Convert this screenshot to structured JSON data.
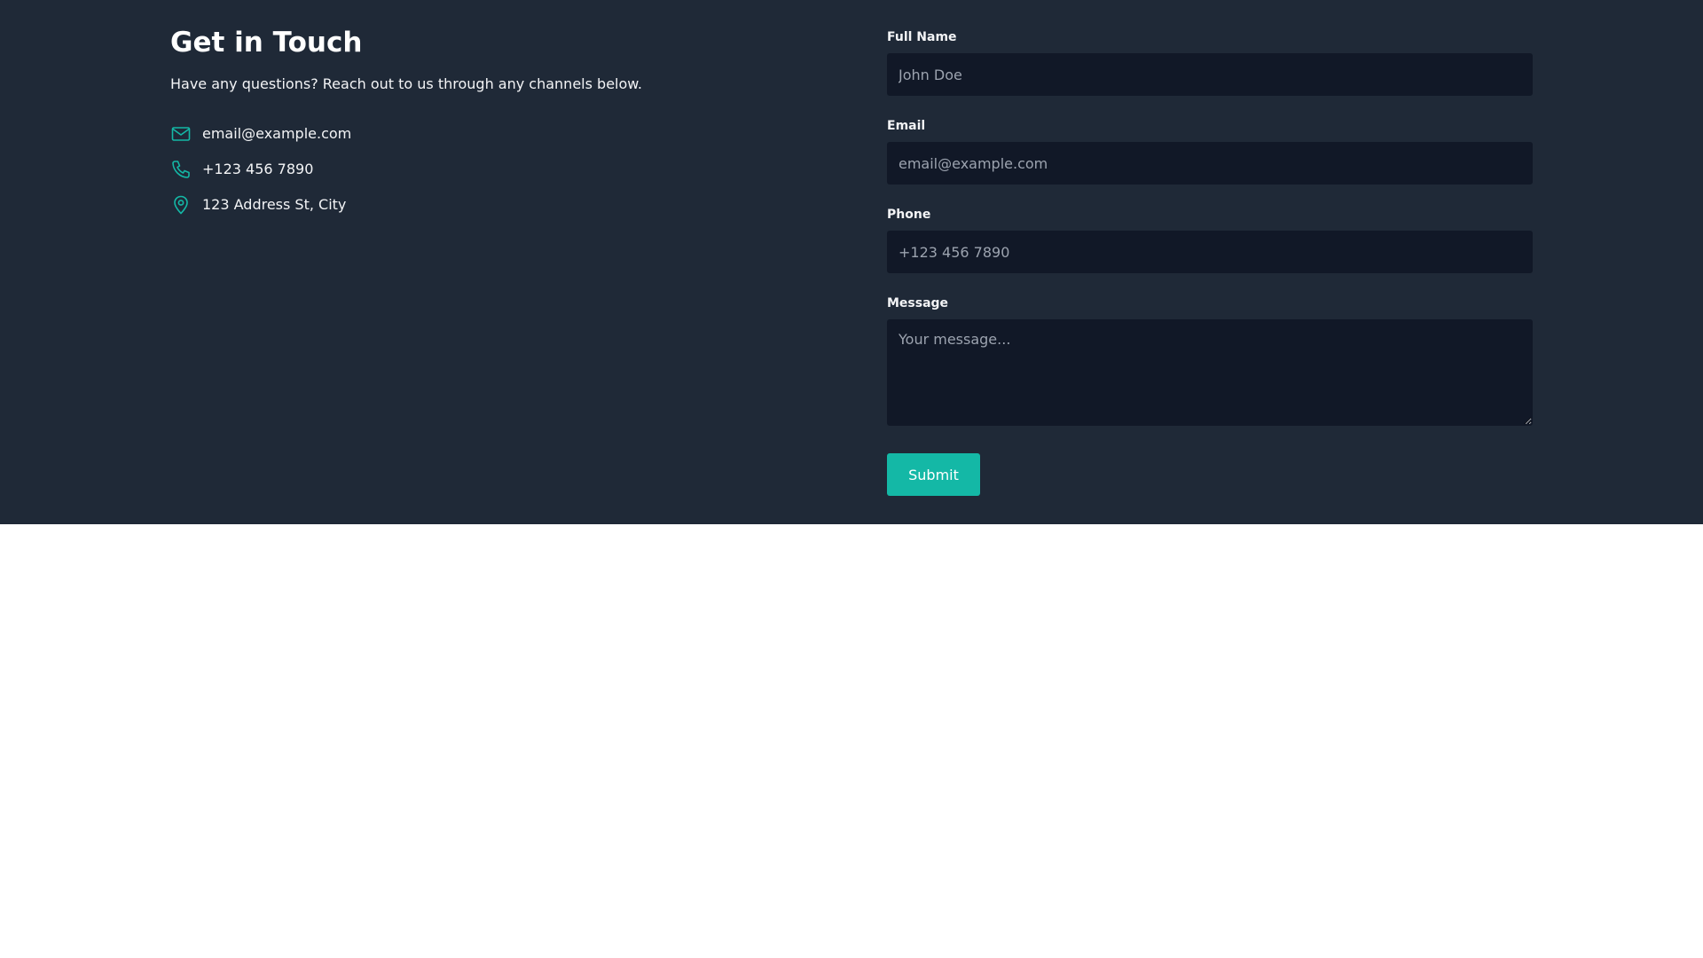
{
  "header": {
    "title": "Get in Touch",
    "subtitle": "Have any questions? Reach out to us through any channels below."
  },
  "contact_items": [
    {
      "icon": "mail-icon",
      "text": "email@example.com"
    },
    {
      "icon": "phone-icon",
      "text": "+123 456 7890"
    },
    {
      "icon": "map-pin-icon",
      "text": "123 Address St, City"
    }
  ],
  "form": {
    "full_name": {
      "label": "Full Name",
      "placeholder": "John Doe",
      "value": ""
    },
    "email": {
      "label": "Email",
      "placeholder": "email@example.com",
      "value": ""
    },
    "phone": {
      "label": "Phone",
      "placeholder": "+123 456 7890",
      "value": ""
    },
    "message": {
      "label": "Message",
      "placeholder": "Your message...",
      "value": ""
    },
    "submit_label": "Submit"
  },
  "colors": {
    "section_bg": "#1f2937",
    "field_bg": "#111827",
    "accent": "#14b8a6",
    "text": "#f3f4f6",
    "placeholder": "#9ca3af",
    "page_bg": "#ffffff"
  }
}
